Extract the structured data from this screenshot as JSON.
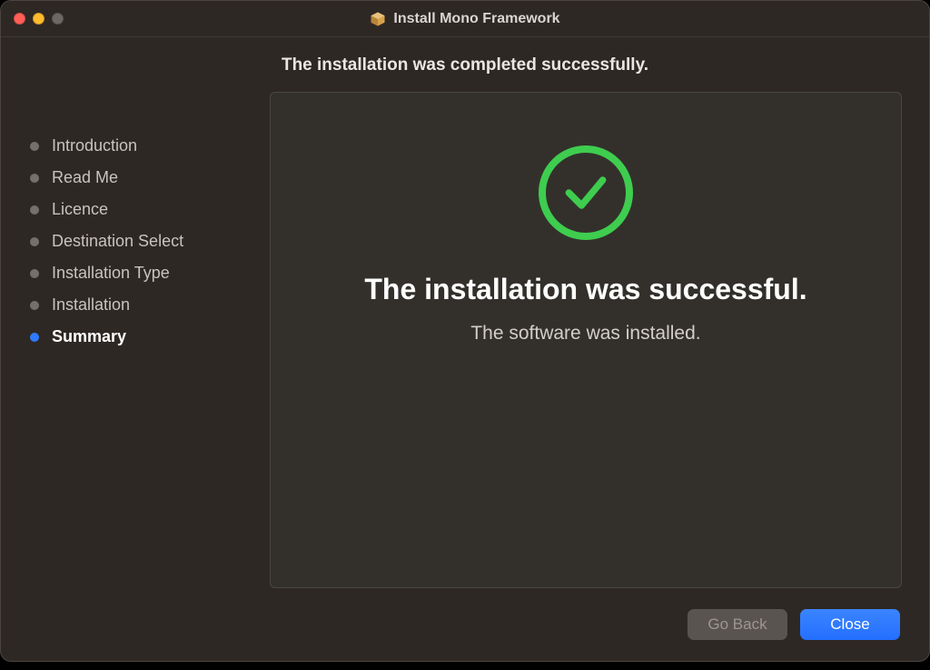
{
  "window": {
    "title": "Install Mono Framework"
  },
  "header": {
    "subtitle": "The installation was completed successfully."
  },
  "sidebar": {
    "steps": [
      {
        "label": "Introduction",
        "active": false
      },
      {
        "label": "Read Me",
        "active": false
      },
      {
        "label": "Licence",
        "active": false
      },
      {
        "label": "Destination Select",
        "active": false
      },
      {
        "label": "Installation Type",
        "active": false
      },
      {
        "label": "Installation",
        "active": false
      },
      {
        "label": "Summary",
        "active": true
      }
    ]
  },
  "panel": {
    "heading": "The installation was successful.",
    "subtext": "The software was installed."
  },
  "footer": {
    "back_label": "Go Back",
    "close_label": "Close"
  },
  "colors": {
    "accent": "#2f7bff",
    "success": "#3ecd4e",
    "panel_bg": "#33302c",
    "window_bg": "#2e2825"
  }
}
